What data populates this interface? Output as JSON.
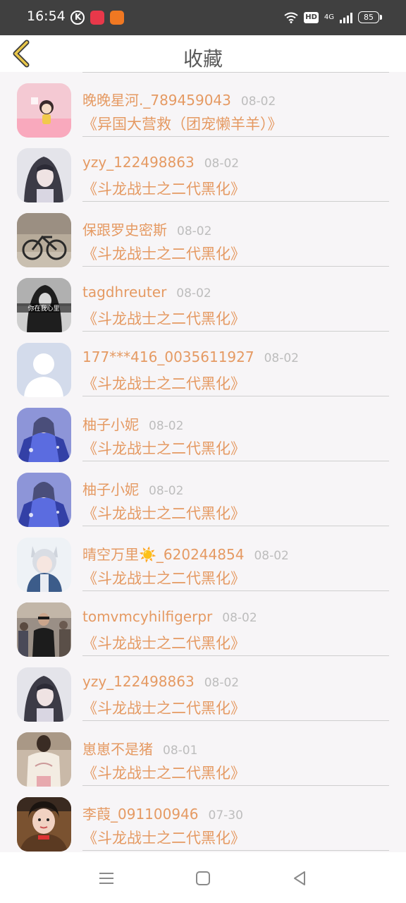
{
  "status_bar": {
    "time": "16:54",
    "battery": "85",
    "network": "4G",
    "hd": "HD"
  },
  "header": {
    "title": "收藏"
  },
  "favorites": [
    {
      "name": "晚晚星河._789459043",
      "date": "08-02",
      "title": "《异国大营救（团宠懒羊羊）》",
      "avatar": "pink-cartoon"
    },
    {
      "name": "yzy_122498863",
      "date": "08-02",
      "title": "《斗龙战士之二代黑化》",
      "avatar": "anime-dark-hair"
    },
    {
      "name": "保跟罗史密斯",
      "date": "08-02",
      "title": "《斗龙战士之二代黑化》",
      "avatar": "bicycle-photo"
    },
    {
      "name": "tagdhreuter",
      "date": "08-02",
      "title": "《斗龙战士之二代黑化》",
      "avatar": "dark-figure-caption",
      "avatar_caption": "你在我心里"
    },
    {
      "name": "177***416_0035611927",
      "date": "08-02",
      "title": "《斗龙战士之二代黑化》",
      "avatar": "default-silhouette"
    },
    {
      "name": "柚子小妮",
      "date": "08-02",
      "title": "《斗龙战士之二代黑化》",
      "avatar": "anime-blue-dress"
    },
    {
      "name": "柚子小妮",
      "date": "08-02",
      "title": "《斗龙战士之二代黑化》",
      "avatar": "anime-blue-dress"
    },
    {
      "name": "晴空万里☀️_620244854",
      "date": "08-02",
      "title": "《斗龙战士之二代黑化》",
      "avatar": "anime-cat-ears"
    },
    {
      "name": "tomvmcyhilfigerpr",
      "date": "08-02",
      "title": "《斗龙战士之二代黑化》",
      "avatar": "street-photo"
    },
    {
      "name": "yzy_122498863",
      "date": "08-02",
      "title": "《斗龙战士之二代黑化》",
      "avatar": "anime-dark-hair"
    },
    {
      "name": "崽崽不是猪",
      "date": "08-01",
      "title": "《斗龙战士之二代黑化》",
      "avatar": "sweater-photo"
    },
    {
      "name": "李葭_091100946",
      "date": "07-30",
      "title": "《斗龙战士之二代黑化》",
      "avatar": "child-photo"
    }
  ],
  "nav_bar": {
    "icons": [
      "menu-icon",
      "home-icon",
      "back-triangle-icon"
    ]
  },
  "colors": {
    "accent": "#e59a63",
    "date": "#bdbdbd",
    "back_arrow": "#e8c64a",
    "status_bar": "#404040"
  }
}
